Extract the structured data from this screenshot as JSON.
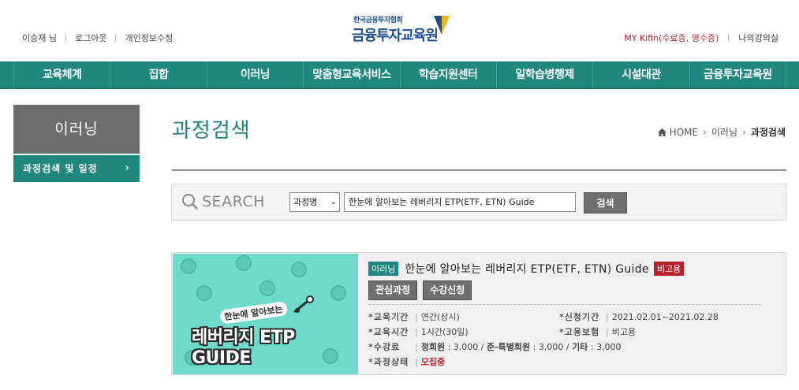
{
  "header": {
    "user_name": "이승재 님",
    "logout": "로그아웃",
    "edit_profile": "개인정보수정",
    "logo_small": "한국금융투자협회",
    "logo_big": "금융투자교육원",
    "my_kifin": "MY Kifin(수료증, 영수증)",
    "my_classroom": "나의강의실"
  },
  "gnb": {
    "items": [
      "교육체계",
      "집합",
      "이러닝",
      "맞춤형교육서비스",
      "학습지원센터",
      "일학습병행제",
      "시설대관",
      "금융투자교육원"
    ]
  },
  "lnb": {
    "title": "이러닝",
    "sub_item": "과정검색 및 일정",
    "sub_arrow": "›"
  },
  "page": {
    "title": "과정검색",
    "breadcrumb": [
      "HOME",
      "이러닝",
      "과정검색"
    ]
  },
  "search": {
    "label": "SEARCH",
    "select_value": "과정명",
    "input_value": "한눈에 알아보는 레버리지 ETP(ETF, ETN) Guide",
    "button": "검색"
  },
  "course": {
    "category": "이러닝",
    "title": "한눈에 알아보는 레버리지 ETP(ETF, ETN) Guide",
    "employment_badge": "비고용",
    "thumb_text_small": "한눈에 알아보는",
    "thumb_text_big": "레버리지 ETP GUIDE",
    "buttons": {
      "interest": "관심과정",
      "apply": "수강신청"
    },
    "info_left": [
      {
        "key": "*교육기간",
        "value": "연간(상시)"
      },
      {
        "key": "*교육시간",
        "value": "1시간(30일)"
      },
      {
        "key": "*수강료",
        "value": ""
      },
      {
        "key": "*과정상태",
        "value": "모집중"
      }
    ],
    "info_right": [
      {
        "key": "*신청기간",
        "value": "2021.02.01~2021.02.28"
      },
      {
        "key": "*고용보험",
        "value": "비고용"
      }
    ],
    "fee_line": {
      "regular_label": "정회원",
      "regular_value": ": 3,000 /",
      "semi_label": "준-특별회원",
      "semi_value": ": 3,000 /",
      "other_label": "기타",
      "other_value": ": 3,000"
    }
  },
  "colors": {
    "teal": "#20877f",
    "gray_box": "#6d6d6d",
    "red": "#b8202a"
  }
}
